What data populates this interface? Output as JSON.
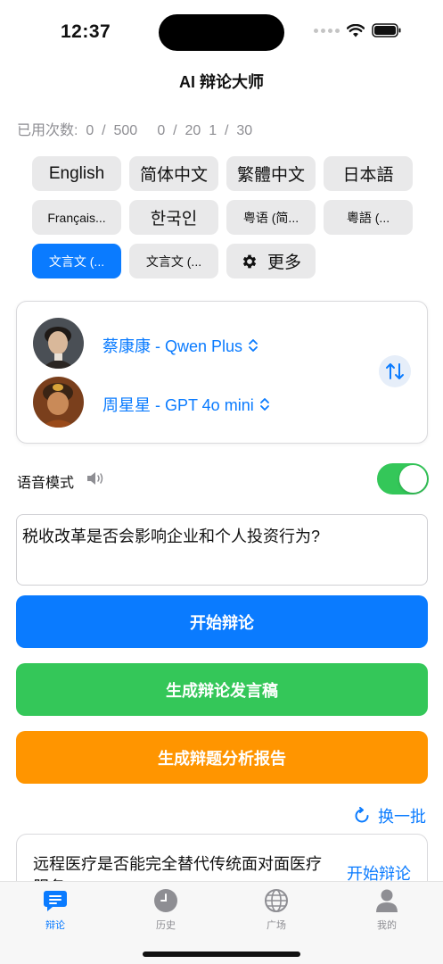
{
  "status_bar": {
    "time": "12:37"
  },
  "nav": {
    "title": "AI 辩论大师"
  },
  "usage": {
    "text": "已用次数:  0  /  500     0  /  20  1  /  30"
  },
  "languages": [
    {
      "label": "English",
      "selected": false,
      "small": false
    },
    {
      "label": "简体中文",
      "selected": false,
      "small": false
    },
    {
      "label": "繁體中文",
      "selected": false,
      "small": false
    },
    {
      "label": "日本語",
      "selected": false,
      "small": false
    },
    {
      "label": "Français...",
      "selected": false,
      "small": true
    },
    {
      "label": "한국인",
      "selected": false,
      "small": false
    },
    {
      "label": "粤语 (简...",
      "selected": false,
      "small": true
    },
    {
      "label": "粵語 (...",
      "selected": false,
      "small": true
    },
    {
      "label": "文言文 (...",
      "selected": true,
      "small": true
    },
    {
      "label": "文言文 (...",
      "selected": false,
      "small": true
    }
  ],
  "more_button": {
    "label": "更多",
    "icon": "gear-icon"
  },
  "debaters": [
    {
      "name": "蔡康康 - Qwen Plus"
    },
    {
      "name": "周星星 - GPT 4o mini"
    }
  ],
  "voice": {
    "label": "语音模式",
    "enabled": true
  },
  "topic": {
    "value": "税收改革是否会影响企业和个人投资行为?"
  },
  "actions": {
    "start": "开始辩论",
    "speech": "生成辩论发言稿",
    "report": "生成辩题分析报告"
  },
  "refresh": {
    "label": "换一批"
  },
  "suggestion": {
    "text": "远程医疗是否能完全替代传统面对面医疗服务?",
    "action": "开始辩论"
  },
  "tabs": [
    {
      "label": "辩论",
      "icon": "chat-icon",
      "active": true
    },
    {
      "label": "历史",
      "icon": "clock-icon",
      "active": false
    },
    {
      "label": "广场",
      "icon": "globe-icon",
      "active": false
    },
    {
      "label": "我的",
      "icon": "person-icon",
      "active": false
    }
  ],
  "colors": {
    "accent": "#0a7bff",
    "green": "#34c759",
    "orange": "#ff9500"
  }
}
